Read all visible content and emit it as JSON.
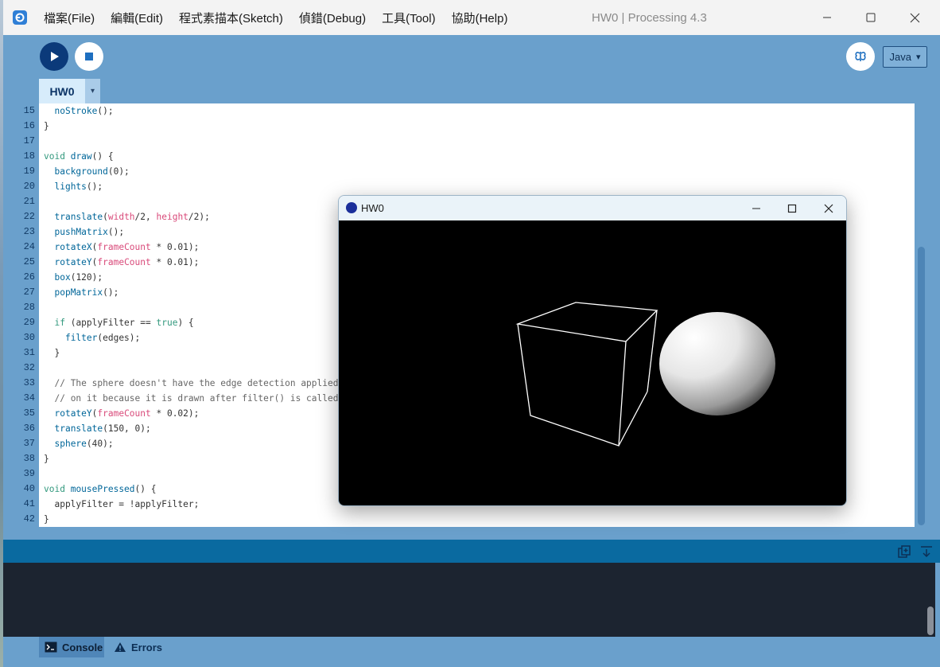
{
  "window": {
    "title": "HW0 | Processing 4.3",
    "controls": [
      "minimize",
      "maximize",
      "close"
    ]
  },
  "menu": [
    {
      "label": "檔案(File)"
    },
    {
      "label": "編輯(Edit)"
    },
    {
      "label": "程式素描本(Sketch)"
    },
    {
      "label": "偵錯(Debug)"
    },
    {
      "label": "工具(Tool)"
    },
    {
      "label": "協助(Help)"
    }
  ],
  "toolbar": {
    "run_icon": "play-icon",
    "stop_icon": "stop-icon",
    "debug_icon": "butterfly-icon",
    "mode": "Java",
    "mode_arrow": "▾"
  },
  "tabs": {
    "active": "HW0",
    "menu_arrow": "▾"
  },
  "editor": {
    "lines": [
      {
        "n": "15",
        "html": "  <span class='t-fn'>noStroke</span>();"
      },
      {
        "n": "16",
        "html": "}"
      },
      {
        "n": "17",
        "html": ""
      },
      {
        "n": "18",
        "html": "<span class='t-kw'>void</span> <span class='t-fn'>draw</span>() {"
      },
      {
        "n": "19",
        "html": "  <span class='t-fn'>background</span>(0);"
      },
      {
        "n": "20",
        "html": "  <span class='t-fn'>lights</span>();"
      },
      {
        "n": "21",
        "html": ""
      },
      {
        "n": "22",
        "html": "  <span class='t-fn'>translate</span>(<span class='t-var'>width</span>/2, <span class='t-var'>height</span>/2);"
      },
      {
        "n": "23",
        "html": "  <span class='t-fn'>pushMatrix</span>();"
      },
      {
        "n": "24",
        "html": "  <span class='t-fn'>rotateX</span>(<span class='t-var'>frameCount</span> * 0.01);"
      },
      {
        "n": "25",
        "html": "  <span class='t-fn'>rotateY</span>(<span class='t-var'>frameCount</span> * 0.01);"
      },
      {
        "n": "26",
        "html": "  <span class='t-fn'>box</span>(120);"
      },
      {
        "n": "27",
        "html": "  <span class='t-fn'>popMatrix</span>();"
      },
      {
        "n": "28",
        "html": ""
      },
      {
        "n": "29",
        "html": "  <span class='t-kw'>if</span> (applyFilter == <span class='t-kw'>true</span>) {"
      },
      {
        "n": "30",
        "html": "    <span class='t-fn'>filter</span>(edges);"
      },
      {
        "n": "31",
        "html": "  }"
      },
      {
        "n": "32",
        "html": ""
      },
      {
        "n": "33",
        "html": "  <span class='t-cm'>// The sphere doesn't have the edge detection applied</span>"
      },
      {
        "n": "34",
        "html": "  <span class='t-cm'>// on it because it is drawn after filter() is called.</span>"
      },
      {
        "n": "35",
        "html": "  <span class='t-fn'>rotateY</span>(<span class='t-var'>frameCount</span> * 0.02);"
      },
      {
        "n": "36",
        "html": "  <span class='t-fn'>translate</span>(150, 0);"
      },
      {
        "n": "37",
        "html": "  <span class='t-fn'>sphere</span>(40);"
      },
      {
        "n": "38",
        "html": "}"
      },
      {
        "n": "39",
        "html": ""
      },
      {
        "n": "40",
        "html": "<span class='t-kw'>void</span> <span class='t-fn'>mousePressed</span>() {"
      },
      {
        "n": "41",
        "html": "  applyFilter = !applyFilter;"
      },
      {
        "n": "42",
        "html": "}"
      }
    ]
  },
  "console": {
    "tabs": [
      {
        "label": "Console",
        "icon": "terminal-icon"
      },
      {
        "label": "Errors",
        "icon": "warning-icon"
      }
    ]
  },
  "sketch_window": {
    "title": "HW0",
    "controls": [
      "minimize",
      "maximize",
      "close"
    ]
  },
  "colors": {
    "chrome": "#6aa0cc",
    "run_button": "#0b3a7a",
    "console_header": "#0a6aa0",
    "console_body": "#1c2430"
  }
}
